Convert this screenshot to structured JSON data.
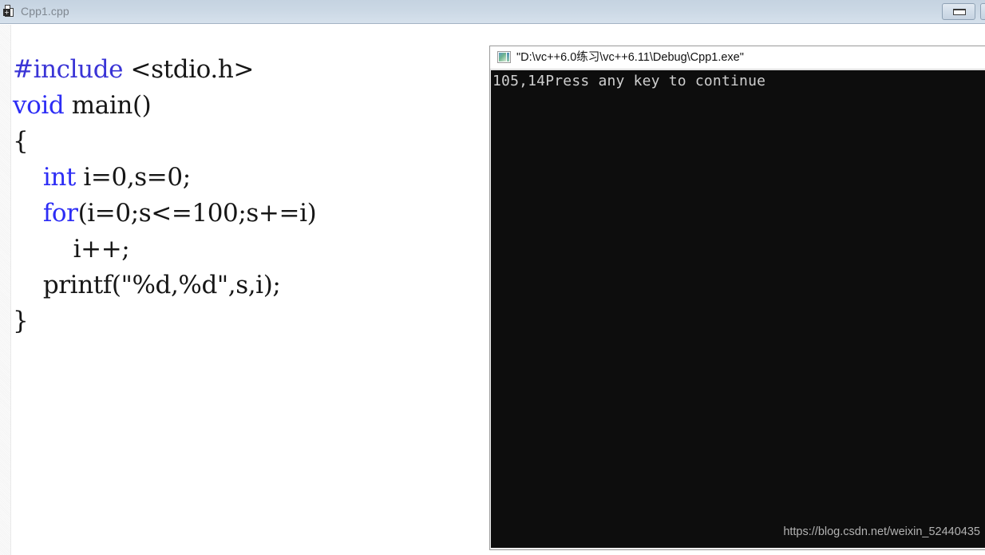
{
  "window": {
    "title": "Cpp1.cpp",
    "icon": "cpp-source-file-icon",
    "controls": [
      {
        "name": "restore-button",
        "glyph": "restore-icon"
      },
      {
        "name": "close-button",
        "glyph": "close-icon"
      }
    ]
  },
  "editor": {
    "language": "c",
    "lines": [
      {
        "id": 1,
        "tokens": [
          {
            "t": "#include ",
            "c": "pp"
          },
          {
            "t": "<stdio.h>",
            "c": "plain"
          }
        ]
      },
      {
        "id": 2,
        "tokens": [
          {
            "t": "void",
            "c": "kw"
          },
          {
            "t": " main()",
            "c": "plain"
          }
        ]
      },
      {
        "id": 3,
        "tokens": [
          {
            "t": "{",
            "c": "plain"
          }
        ]
      },
      {
        "id": 4,
        "tokens": [
          {
            "t": "    ",
            "c": "plain"
          },
          {
            "t": "int",
            "c": "kw"
          },
          {
            "t": " i=0,s=0;",
            "c": "plain"
          }
        ]
      },
      {
        "id": 5,
        "tokens": [
          {
            "t": "    ",
            "c": "plain"
          },
          {
            "t": "for",
            "c": "kw"
          },
          {
            "t": "(i=0;s<=100;s+=i)",
            "c": "plain"
          }
        ]
      },
      {
        "id": 6,
        "tokens": [
          {
            "t": "        i++;",
            "c": "plain"
          }
        ]
      },
      {
        "id": 7,
        "tokens": [
          {
            "t": "    printf(\"%d,%d\",s,i);",
            "c": "plain"
          }
        ]
      },
      {
        "id": 8,
        "tokens": [
          {
            "t": "}",
            "c": "plain"
          }
        ]
      }
    ],
    "plain_text": "#include <stdio.h>\nvoid main()\n{\n    int i=0,s=0;\n    for(i=0;s<=100;s+=i)\n        i++;\n    printf(\"%d,%d\",s,i);\n}"
  },
  "console": {
    "icon": "console-window-icon",
    "title": "\"D:\\vc++6.0练习\\vc++6.11\\Debug\\Cpp1.exe\"",
    "output": "105,14Press any key to continue",
    "background": "#0d0d0d",
    "foreground": "#cfcfcf"
  },
  "watermark": {
    "text": "https://blog.csdn.net/weixin_52440435"
  },
  "colors": {
    "titlebar_top": "#c5d3e1",
    "titlebar_bottom": "#d6e1ec",
    "keyword_blue": "#2d2df5",
    "preprocessor_blue": "#3a34d6",
    "code_black": "#161616",
    "console_black": "#0d0d0d"
  }
}
